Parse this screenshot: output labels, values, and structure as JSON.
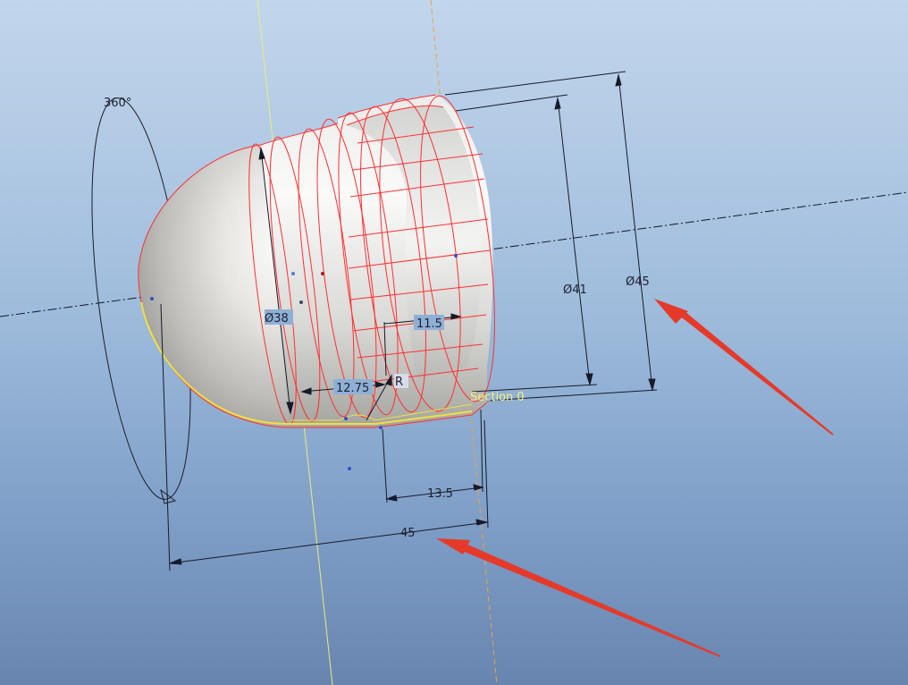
{
  "viewport": {
    "background_top": "#c2d6ec",
    "background_bottom": "#6885b0"
  },
  "model": {
    "edge_color": "#ff3030",
    "surface_color": "#dcdcd8",
    "highlight_edge_color": "#f0e040"
  },
  "annotations": {
    "arrow_color": "#e53a2a"
  },
  "dimensions": {
    "revolve_angle": "360°",
    "dia_41": "Ø41",
    "dia_45": "Ø45",
    "dia_38": "Ø38",
    "len_11_5": "11.5",
    "len_12_75": "12.75",
    "radius": "R",
    "len_13_5": "13.5",
    "len_45": "45"
  },
  "section_label": "Section 0"
}
